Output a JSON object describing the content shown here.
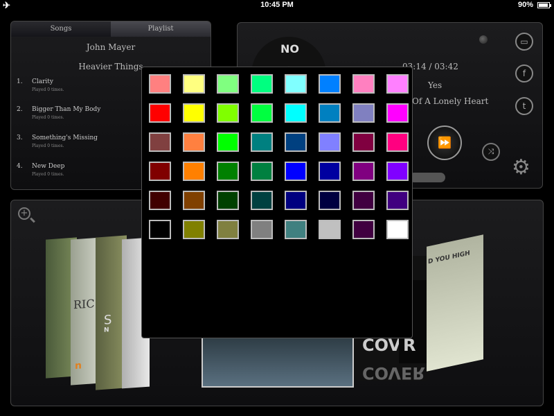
{
  "statusbar": {
    "time": "10:45 PM",
    "battery": "90%",
    "airplane_glyph": "✈"
  },
  "songs_panel": {
    "tabs": [
      "Songs",
      "Playlist"
    ],
    "artist": "John Mayer",
    "album": "Heavier Things",
    "tracks": [
      {
        "num": "1.",
        "title": "Clarity",
        "played": "Played 0 times."
      },
      {
        "num": "2.",
        "title": "Bigger Than My Body",
        "played": "Played 0 times."
      },
      {
        "num": "3.",
        "title": "Something's Missing",
        "played": "Played 0 times."
      },
      {
        "num": "4.",
        "title": "New Deep",
        "played": "Played 0 times."
      }
    ]
  },
  "player": {
    "vinyl_label": "NO",
    "time": "03:14 / 03:42",
    "title": "Yes",
    "album_partial": "Of A Lonely Heart",
    "buttons": {
      "window_glyph": "▭",
      "facebook_glyph": "f",
      "twitter_glyph": "t",
      "fast_forward_glyph": "⏩",
      "shuffle_glyph": "⤨",
      "gear_glyph": "⚙"
    }
  },
  "covers": {
    "texts": {
      "ric": "RIC",
      "s": "S",
      "n": "n",
      "n_small": "N",
      "cover": "COVER",
      "cover_r": "R",
      "cover_reflection": "COVER",
      "you_high": "D YOU HIGH"
    }
  },
  "color_picker": {
    "rows": [
      [
        "#ff8080",
        "#ffff80",
        "#80ff80",
        "#00ff80",
        "#80ffff",
        "#0080ff",
        "#ff80c0",
        "#ff80ff"
      ],
      [
        "#ff0000",
        "#ffff00",
        "#80ff00",
        "#00ff40",
        "#00ffff",
        "#0080c0",
        "#8080c0",
        "#ff00ff"
      ],
      [
        "#804040",
        "#ff8040",
        "#00ff00",
        "#008080",
        "#004080",
        "#8080ff",
        "#800040",
        "#ff0080"
      ],
      [
        "#800000",
        "#ff8000",
        "#008000",
        "#008040",
        "#0000ff",
        "#0000a0",
        "#800080",
        "#8000ff"
      ],
      [
        "#400000",
        "#804000",
        "#004000",
        "#004040",
        "#000080",
        "#000040",
        "#400040",
        "#400080"
      ],
      [
        "#000000",
        "#808000",
        "#808040",
        "#808080",
        "#408080",
        "#c0c0c0",
        "#400040",
        "#ffffff"
      ]
    ]
  }
}
